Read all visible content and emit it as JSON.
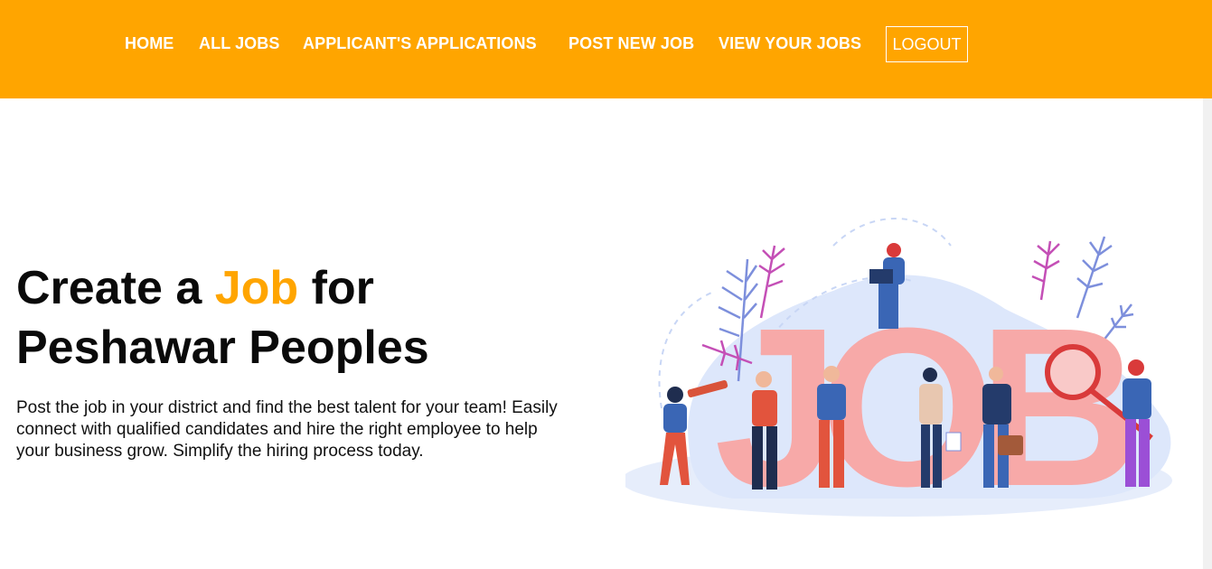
{
  "nav": {
    "items": [
      {
        "label": "HOME"
      },
      {
        "label": "ALL JOBS"
      },
      {
        "label": "APPLICANT'S APPLICATIONS"
      },
      {
        "label": "POST NEW JOB"
      },
      {
        "label": "VIEW YOUR JOBS"
      }
    ],
    "logout_label": "LOGOUT"
  },
  "hero": {
    "title_prefix": "Create a",
    "title_accent": "Job",
    "title_suffix": "for",
    "title_line2": "Peshawar Peoples",
    "description": "Post the job in your district and find the best talent for your team! Easily connect with qualified candidates and hire the right employee to help your business grow. Simplify the hiring process today."
  },
  "illustration": {
    "letters": [
      "J",
      "O",
      "B"
    ]
  },
  "colors": {
    "brand": "#ffa500",
    "text": "#0a0a0a",
    "letter_fill": "#f7a9a8"
  }
}
